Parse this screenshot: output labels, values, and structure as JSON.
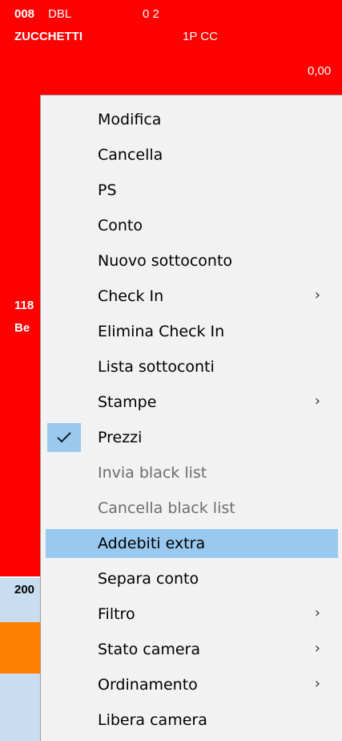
{
  "tiles": {
    "top": {
      "code": "008",
      "type": "DBL",
      "occupancy": "0 2",
      "guest": "ZUCCHETTI",
      "board": "1P CC",
      "amount": "0,00"
    },
    "middle": {
      "code_partial": "118",
      "guest_partial": "Be"
    },
    "lower": {
      "code_partial": "200"
    }
  },
  "menu": {
    "items": [
      {
        "label": "Modifica"
      },
      {
        "label": "Cancella"
      },
      {
        "label": "PS"
      },
      {
        "label": "Conto"
      },
      {
        "label": "Nuovo sottoconto"
      },
      {
        "label": "Check In",
        "submenu": true
      },
      {
        "label": "Elimina Check In"
      },
      {
        "label": "Lista sottoconti"
      },
      {
        "label": "Stampe",
        "submenu": true
      },
      {
        "label": "Prezzi",
        "checked": true
      },
      {
        "label": "Invia black list",
        "disabled": true
      },
      {
        "label": "Cancella black list",
        "disabled": true
      },
      {
        "label": "Addebiti extra",
        "highlighted": true
      },
      {
        "label": "Separa conto"
      },
      {
        "label": "Filtro",
        "submenu": true
      },
      {
        "label": "Stato camera",
        "submenu": true
      },
      {
        "label": "Ordinamento",
        "submenu": true
      },
      {
        "label": "Libera camera"
      }
    ],
    "submenu_glyph": "›"
  },
  "colors": {
    "occupied": "#ff0000",
    "highlight": "#99c9ef",
    "orange": "#ff8000",
    "free": "#c9ddf0"
  }
}
